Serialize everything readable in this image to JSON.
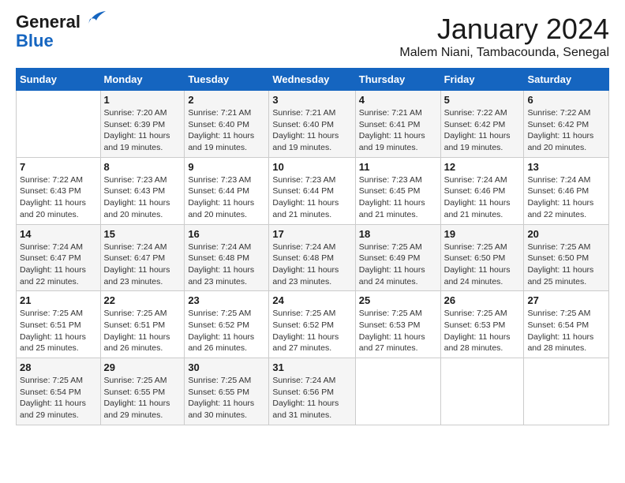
{
  "header": {
    "logo_line1": "General",
    "logo_line2": "Blue",
    "month_title": "January 2024",
    "subtitle": "Malem Niani, Tambacounda, Senegal"
  },
  "days_of_week": [
    "Sunday",
    "Monday",
    "Tuesday",
    "Wednesday",
    "Thursday",
    "Friday",
    "Saturday"
  ],
  "weeks": [
    [
      {
        "num": "",
        "info": ""
      },
      {
        "num": "1",
        "info": "Sunrise: 7:20 AM\nSunset: 6:39 PM\nDaylight: 11 hours and 19 minutes."
      },
      {
        "num": "2",
        "info": "Sunrise: 7:21 AM\nSunset: 6:40 PM\nDaylight: 11 hours and 19 minutes."
      },
      {
        "num": "3",
        "info": "Sunrise: 7:21 AM\nSunset: 6:40 PM\nDaylight: 11 hours and 19 minutes."
      },
      {
        "num": "4",
        "info": "Sunrise: 7:21 AM\nSunset: 6:41 PM\nDaylight: 11 hours and 19 minutes."
      },
      {
        "num": "5",
        "info": "Sunrise: 7:22 AM\nSunset: 6:42 PM\nDaylight: 11 hours and 19 minutes."
      },
      {
        "num": "6",
        "info": "Sunrise: 7:22 AM\nSunset: 6:42 PM\nDaylight: 11 hours and 20 minutes."
      }
    ],
    [
      {
        "num": "7",
        "info": "Sunrise: 7:22 AM\nSunset: 6:43 PM\nDaylight: 11 hours and 20 minutes."
      },
      {
        "num": "8",
        "info": "Sunrise: 7:23 AM\nSunset: 6:43 PM\nDaylight: 11 hours and 20 minutes."
      },
      {
        "num": "9",
        "info": "Sunrise: 7:23 AM\nSunset: 6:44 PM\nDaylight: 11 hours and 20 minutes."
      },
      {
        "num": "10",
        "info": "Sunrise: 7:23 AM\nSunset: 6:44 PM\nDaylight: 11 hours and 21 minutes."
      },
      {
        "num": "11",
        "info": "Sunrise: 7:23 AM\nSunset: 6:45 PM\nDaylight: 11 hours and 21 minutes."
      },
      {
        "num": "12",
        "info": "Sunrise: 7:24 AM\nSunset: 6:46 PM\nDaylight: 11 hours and 21 minutes."
      },
      {
        "num": "13",
        "info": "Sunrise: 7:24 AM\nSunset: 6:46 PM\nDaylight: 11 hours and 22 minutes."
      }
    ],
    [
      {
        "num": "14",
        "info": "Sunrise: 7:24 AM\nSunset: 6:47 PM\nDaylight: 11 hours and 22 minutes."
      },
      {
        "num": "15",
        "info": "Sunrise: 7:24 AM\nSunset: 6:47 PM\nDaylight: 11 hours and 23 minutes."
      },
      {
        "num": "16",
        "info": "Sunrise: 7:24 AM\nSunset: 6:48 PM\nDaylight: 11 hours and 23 minutes."
      },
      {
        "num": "17",
        "info": "Sunrise: 7:24 AM\nSunset: 6:48 PM\nDaylight: 11 hours and 23 minutes."
      },
      {
        "num": "18",
        "info": "Sunrise: 7:25 AM\nSunset: 6:49 PM\nDaylight: 11 hours and 24 minutes."
      },
      {
        "num": "19",
        "info": "Sunrise: 7:25 AM\nSunset: 6:50 PM\nDaylight: 11 hours and 24 minutes."
      },
      {
        "num": "20",
        "info": "Sunrise: 7:25 AM\nSunset: 6:50 PM\nDaylight: 11 hours and 25 minutes."
      }
    ],
    [
      {
        "num": "21",
        "info": "Sunrise: 7:25 AM\nSunset: 6:51 PM\nDaylight: 11 hours and 25 minutes."
      },
      {
        "num": "22",
        "info": "Sunrise: 7:25 AM\nSunset: 6:51 PM\nDaylight: 11 hours and 26 minutes."
      },
      {
        "num": "23",
        "info": "Sunrise: 7:25 AM\nSunset: 6:52 PM\nDaylight: 11 hours and 26 minutes."
      },
      {
        "num": "24",
        "info": "Sunrise: 7:25 AM\nSunset: 6:52 PM\nDaylight: 11 hours and 27 minutes."
      },
      {
        "num": "25",
        "info": "Sunrise: 7:25 AM\nSunset: 6:53 PM\nDaylight: 11 hours and 27 minutes."
      },
      {
        "num": "26",
        "info": "Sunrise: 7:25 AM\nSunset: 6:53 PM\nDaylight: 11 hours and 28 minutes."
      },
      {
        "num": "27",
        "info": "Sunrise: 7:25 AM\nSunset: 6:54 PM\nDaylight: 11 hours and 28 minutes."
      }
    ],
    [
      {
        "num": "28",
        "info": "Sunrise: 7:25 AM\nSunset: 6:54 PM\nDaylight: 11 hours and 29 minutes."
      },
      {
        "num": "29",
        "info": "Sunrise: 7:25 AM\nSunset: 6:55 PM\nDaylight: 11 hours and 29 minutes."
      },
      {
        "num": "30",
        "info": "Sunrise: 7:25 AM\nSunset: 6:55 PM\nDaylight: 11 hours and 30 minutes."
      },
      {
        "num": "31",
        "info": "Sunrise: 7:24 AM\nSunset: 6:56 PM\nDaylight: 11 hours and 31 minutes."
      },
      {
        "num": "",
        "info": ""
      },
      {
        "num": "",
        "info": ""
      },
      {
        "num": "",
        "info": ""
      }
    ]
  ]
}
